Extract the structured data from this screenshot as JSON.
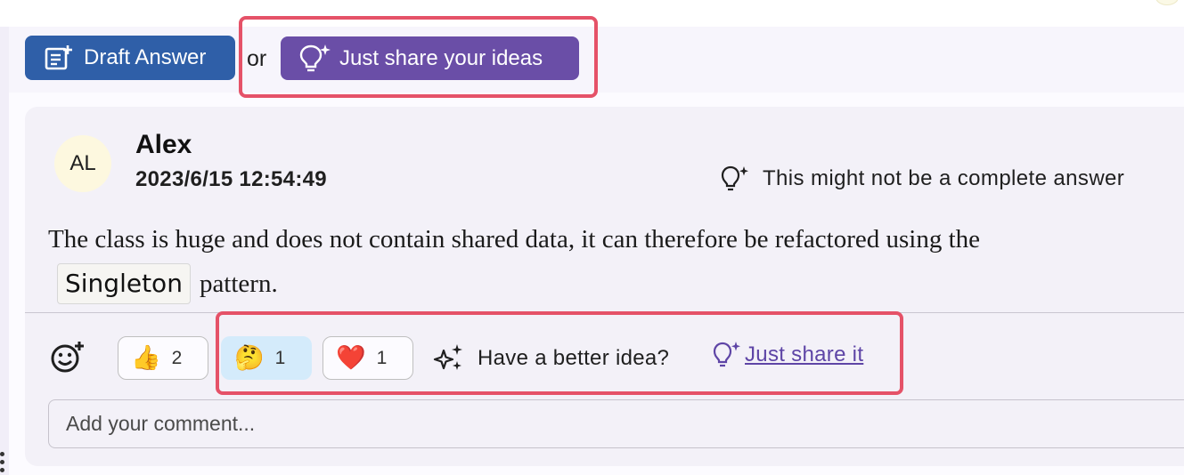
{
  "action_bar": {
    "draft_button_label": "Draft Answer",
    "or_label": "or",
    "share_ideas_button_label": "Just share your ideas",
    "draft_icon": "document-edit-icon",
    "share_icon": "lightbulb-sparkle-icon"
  },
  "answer": {
    "avatar_initials": "AL",
    "author": "Alex",
    "timestamp": "2023/6/15 12:54:49",
    "incomplete_notice": "This might not be a complete answer",
    "body_before_code": "The class is huge and does not contain shared data, it can therefore be refactored using the",
    "code_term": "Singleton",
    "body_after_code": "pattern."
  },
  "reactions": [
    {
      "emoji": "👍",
      "count": "2",
      "icon": "thumbs-up-icon"
    },
    {
      "emoji": "🤔",
      "count": "1",
      "icon": "thinking-face-icon",
      "selected": true
    },
    {
      "emoji": "❤️",
      "count": "1",
      "icon": "heart-icon"
    }
  ],
  "feedback": {
    "better_idea_text": "Have a better idea?",
    "share_it_link": "Just share it"
  },
  "comment": {
    "placeholder": "Add your comment..."
  },
  "colors": {
    "draft_button": "#2f5fa8",
    "share_button": "#6a4ea7",
    "highlight_border": "#e55268",
    "link": "#5e45a6",
    "selected_reaction": "#d4ebfb"
  }
}
